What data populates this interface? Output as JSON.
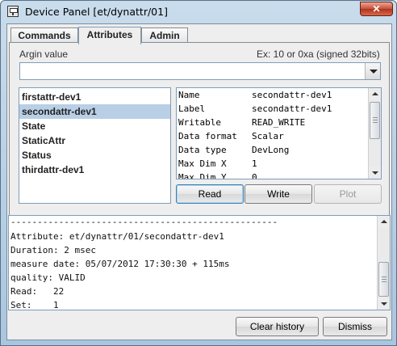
{
  "window": {
    "title": "Device Panel [et/dynattr/01]",
    "close_label": "✕"
  },
  "tabs": [
    {
      "label": "Commands",
      "active": false
    },
    {
      "label": "Attributes",
      "active": true
    },
    {
      "label": "Admin",
      "active": false
    }
  ],
  "argin": {
    "label": "Argin value",
    "hint": "Ex: 10 or 0xa (signed 32bits)",
    "value": ""
  },
  "attributes": [
    {
      "label": "firstattr-dev1",
      "selected": false
    },
    {
      "label": "secondattr-dev1",
      "selected": true
    },
    {
      "label": "State",
      "selected": false
    },
    {
      "label": "StaticAttr",
      "selected": false
    },
    {
      "label": "Status",
      "selected": false
    },
    {
      "label": "thirdattr-dev1",
      "selected": false
    }
  ],
  "properties": [
    {
      "key": "Name",
      "value": "secondattr-dev1"
    },
    {
      "key": "Label",
      "value": "secondattr-dev1"
    },
    {
      "key": "Writable",
      "value": "READ_WRITE"
    },
    {
      "key": "Data format",
      "value": "Scalar"
    },
    {
      "key": "Data type",
      "value": "DevLong"
    },
    {
      "key": "Max Dim X",
      "value": "1"
    },
    {
      "key": "Max Dim Y",
      "value": "0"
    }
  ],
  "actions": {
    "read": "Read",
    "write": "Write",
    "plot": "Plot"
  },
  "log": [
    "--------------------------------------------------",
    "Attribute: et/dynattr/01/secondattr-dev1",
    "Duration: 2 msec",
    "measure date: 05/07/2012 17:30:30 + 115ms",
    "quality: VALID",
    "Read:   22",
    "Set:    1"
  ],
  "footer": {
    "clear_history": "Clear history",
    "dismiss": "Dismiss"
  },
  "colors": {
    "selection": "#b8cfe5",
    "input_border": "#7f9db9",
    "close_button": "#c75038"
  }
}
